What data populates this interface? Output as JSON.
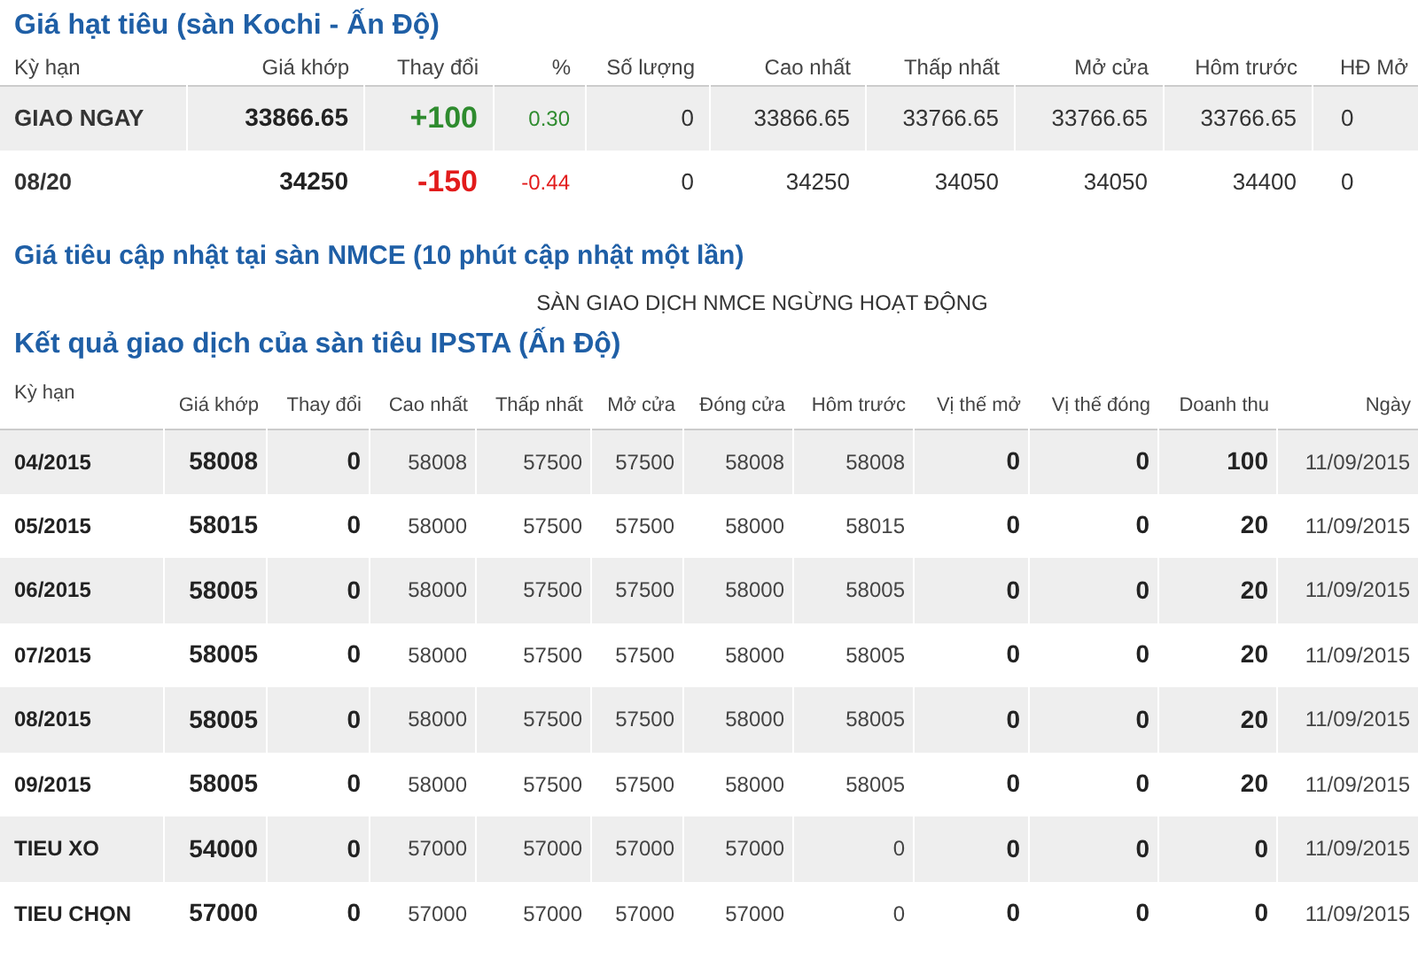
{
  "kochi": {
    "title": "Giá hạt tiêu (sàn Kochi - Ấn Độ)",
    "columns": [
      "Kỳ hạn",
      "Giá khớp",
      "Thay đổi",
      "%",
      "Số lượng",
      "Cao nhất",
      "Thấp nhất",
      "Mở cửa",
      "Hôm trước",
      "HĐ Mở"
    ],
    "rows": [
      {
        "term": "GIAO NGAY",
        "price": "33866.65",
        "change": "+100",
        "kind": "up",
        "percent": "0.30",
        "volume": "0",
        "high": "33866.65",
        "low": "33766.65",
        "open": "33766.65",
        "previous": "33766.65",
        "open_contracts": "0"
      },
      {
        "term": "08/20",
        "price": "34250",
        "change": "-150",
        "kind": "down",
        "percent": "-0.44",
        "volume": "0",
        "high": "34250",
        "low": "34050",
        "open": "34050",
        "previous": "34400",
        "open_contracts": "0"
      }
    ]
  },
  "nmce": {
    "title": "Giá tiêu cập nhật tại sàn NMCE (10 phút cập nhật một lần)",
    "notice": "SÀN GIAO DỊCH NMCE NGỪNG HOẠT ĐỘNG"
  },
  "ipsta": {
    "title": "Kết quả giao dịch của sàn tiêu IPSTA (Ấn Độ)",
    "columns": [
      "Kỳ hạn",
      "Giá khớp",
      "Thay đổi",
      "Cao nhất",
      "Thấp nhất",
      "Mở cửa",
      "Đóng cửa",
      "Hôm trước",
      "Vị thế mở",
      "Vị thế đóng",
      "Doanh thu",
      "Ngày"
    ],
    "rows": [
      [
        "04/2015",
        "58008",
        "0",
        "58008",
        "57500",
        "57500",
        "58008",
        "58008",
        "0",
        "0",
        "100",
        "11/09/2015"
      ],
      [
        "05/2015",
        "58015",
        "0",
        "58000",
        "57500",
        "57500",
        "58000",
        "58015",
        "0",
        "0",
        "20",
        "11/09/2015"
      ],
      [
        "06/2015",
        "58005",
        "0",
        "58000",
        "57500",
        "57500",
        "58000",
        "58005",
        "0",
        "0",
        "20",
        "11/09/2015"
      ],
      [
        "07/2015",
        "58005",
        "0",
        "58000",
        "57500",
        "57500",
        "58000",
        "58005",
        "0",
        "0",
        "20",
        "11/09/2015"
      ],
      [
        "08/2015",
        "58005",
        "0",
        "58000",
        "57500",
        "57500",
        "58000",
        "58005",
        "0",
        "0",
        "20",
        "11/09/2015"
      ],
      [
        "09/2015",
        "58005",
        "0",
        "58000",
        "57500",
        "57500",
        "58000",
        "58005",
        "0",
        "0",
        "20",
        "11/09/2015"
      ],
      [
        "TIEU XO",
        "54000",
        "0",
        "57000",
        "57000",
        "57000",
        "57000",
        "0",
        "0",
        "0",
        "0",
        "11/09/2015"
      ],
      [
        "TIEU CHỌN",
        "57000",
        "0",
        "57000",
        "57000",
        "57000",
        "57000",
        "0",
        "0",
        "0",
        "0",
        "11/09/2015"
      ]
    ]
  }
}
